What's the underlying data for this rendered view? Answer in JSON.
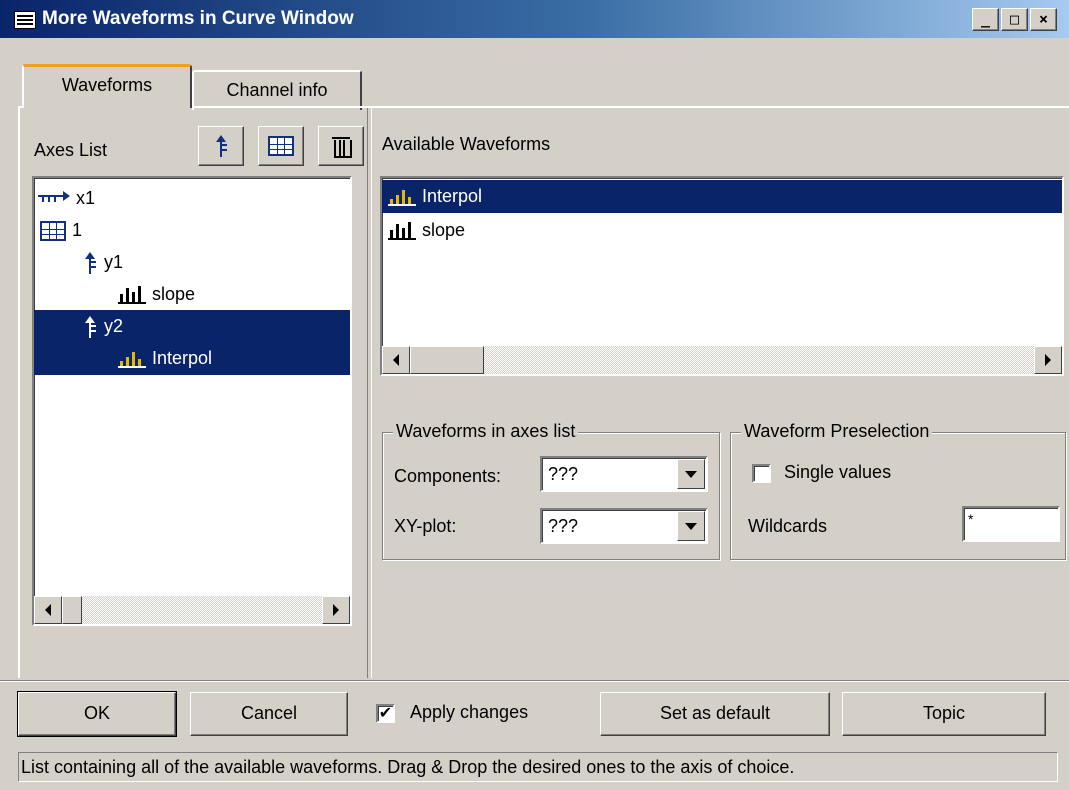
{
  "window": {
    "title": "More Waveforms in Curve Window",
    "minimize": "_",
    "maximize": "□",
    "close": "×"
  },
  "tabs": [
    {
      "label": "Waveforms",
      "active": true
    },
    {
      "label": "Channel info",
      "active": false
    }
  ],
  "axes_list": {
    "label": "Axes List",
    "toolbar": {
      "add_axis_icon": "add-y-axis-icon",
      "add_system_icon": "grid-icon",
      "delete_icon": "trash-icon"
    },
    "items": [
      {
        "label": "x1",
        "icon": "x-axis-icon",
        "level": 0,
        "selected": false
      },
      {
        "label": "1",
        "icon": "grid-icon",
        "level": 0,
        "selected": false
      },
      {
        "label": "y1",
        "icon": "y-axis-icon",
        "level": 1,
        "selected": false
      },
      {
        "label": "slope",
        "icon": "waveform-icon",
        "level": 2,
        "selected": false
      },
      {
        "label": "y2",
        "icon": "y-axis-icon",
        "level": 1,
        "selected": true
      },
      {
        "label": "Interpol",
        "icon": "waveform-icon",
        "level": 2,
        "selected": true
      }
    ]
  },
  "available_waveforms": {
    "label": "Available Waveforms",
    "items": [
      {
        "label": "Interpol",
        "icon": "waveform-icon",
        "selected": true
      },
      {
        "label": "slope",
        "icon": "waveform-icon",
        "selected": false
      }
    ]
  },
  "waveforms_in_axes_list": {
    "title": "Waveforms in axes list",
    "components_label": "Components:",
    "components_value": "???",
    "xy_plot_label": "XY-plot:",
    "xy_plot_value": "???"
  },
  "waveform_preselection": {
    "title": "Waveform Preselection",
    "single_values_label": "Single values",
    "single_values_checked": false,
    "wildcards_label": "Wildcards",
    "wildcards_value": "*"
  },
  "buttons": {
    "ok": "OK",
    "cancel": "Cancel",
    "apply_changes_label": "Apply changes",
    "apply_changes_checked": true,
    "set_as_default": "Set as default",
    "topic": "Topic"
  },
  "status_text": "List containing all of the available waveforms. Drag & Drop the desired ones to the axis of choice.",
  "colors": {
    "selection": "#0a246a",
    "face": "#d4d0c8",
    "tab_highlight": "#f0a020"
  }
}
